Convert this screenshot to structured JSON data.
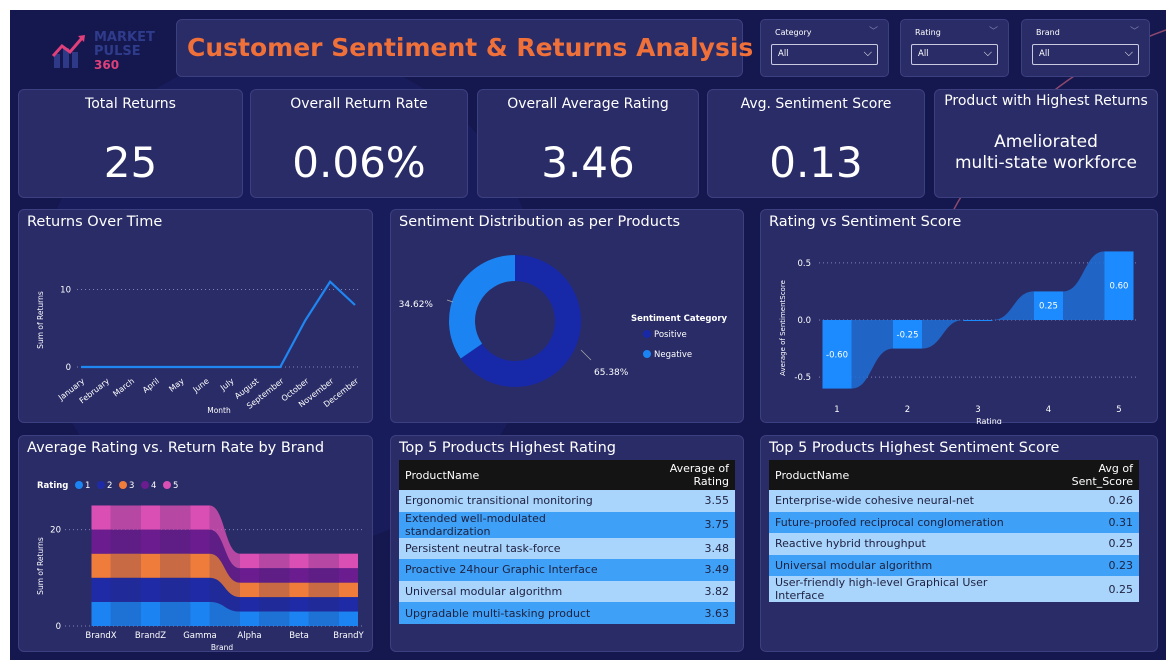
{
  "header": {
    "logo_line1": "MARKET",
    "logo_line2": "PULSE",
    "logo_line3": "360",
    "title": "Customer Sentiment & Returns Analysis"
  },
  "filters": [
    {
      "label": "Category",
      "value": "All"
    },
    {
      "label": "Rating",
      "value": "All"
    },
    {
      "label": "Brand",
      "value": "All"
    }
  ],
  "kpis": {
    "total_returns": {
      "label": "Total Returns",
      "value": "25"
    },
    "return_rate": {
      "label": "Overall Return Rate",
      "value": "0.06%"
    },
    "avg_rating": {
      "label": "Overall Average Rating",
      "value": "3.46"
    },
    "sentiment": {
      "label": "Avg. Sentiment Score",
      "value": "0.13"
    },
    "top_product": {
      "label": "Product with Highest Returns",
      "value_line1": "Ameliorated",
      "value_line2": "multi-state workforce"
    }
  },
  "colors": {
    "accent_orange": "#f0703a",
    "positive": "#1728a8",
    "negative": "#1b84f2",
    "line": "#1f86f2"
  },
  "returns_over_time": {
    "title": "Returns Over Time",
    "chart_data": {
      "type": "line",
      "categories": [
        "January",
        "February",
        "March",
        "April",
        "May",
        "June",
        "July",
        "August",
        "September",
        "October",
        "November",
        "December"
      ],
      "values": [
        0,
        0,
        0,
        0,
        0,
        0,
        0,
        0,
        0,
        6,
        11,
        8
      ],
      "xlabel": "Month",
      "ylabel": "Sum of Returns",
      "yticks": [
        0,
        10
      ],
      "ylim": [
        0,
        12
      ]
    }
  },
  "sentiment_distribution": {
    "title": "Sentiment Distribution as per Products",
    "legend_title": "Sentiment Category",
    "chart_data": {
      "type": "pie",
      "slices": [
        {
          "name": "Positive",
          "value": 65.38,
          "label": "65.38%",
          "color": "#1728a8"
        },
        {
          "name": "Negative",
          "value": 34.62,
          "label": "34.62%",
          "color": "#1b84f2"
        }
      ]
    }
  },
  "rating_vs_sentiment": {
    "title": "Rating vs Sentiment Score",
    "chart_data": {
      "type": "bar",
      "categories": [
        "1",
        "2",
        "3",
        "4",
        "5"
      ],
      "values": [
        -0.6,
        -0.25,
        0.0,
        0.25,
        0.6
      ],
      "labels": [
        "-0.60",
        "-0.25",
        "",
        "0.25",
        "0.60"
      ],
      "xlabel": "Rating",
      "ylabel": "Average of SentimentScore",
      "yticks": [
        "0.5",
        "0.0",
        "-0.5"
      ],
      "ylim": [
        -0.7,
        0.7
      ]
    }
  },
  "rating_vs_return": {
    "title": "Average Rating vs. Return Rate by Brand",
    "legend_title": "Rating",
    "chart_data": {
      "type": "bar",
      "stacked": true,
      "categories": [
        "BrandX",
        "BrandZ",
        "Gamma",
        "Alpha",
        "Beta",
        "BrandY"
      ],
      "series": [
        {
          "name": "1",
          "color": "#1b84f2",
          "values": [
            5,
            5,
            5,
            3,
            3,
            3
          ]
        },
        {
          "name": "2",
          "color": "#1f2ba6",
          "values": [
            5,
            5,
            5,
            3,
            3,
            3
          ]
        },
        {
          "name": "3",
          "color": "#f07c3c",
          "values": [
            5,
            5,
            5,
            3,
            3,
            3
          ]
        },
        {
          "name": "4",
          "color": "#6b1c8f",
          "values": [
            5,
            5,
            5,
            3,
            3,
            3
          ]
        },
        {
          "name": "5",
          "color": "#d94fb3",
          "values": [
            5,
            5,
            5,
            3,
            3,
            3
          ]
        }
      ],
      "xlabel": "Brand",
      "ylabel": "Sum of Returns",
      "yticks": [
        0,
        20
      ],
      "ylim": [
        0,
        28
      ]
    }
  },
  "top_rating": {
    "title": "Top 5 Products Highest Rating",
    "columns": [
      "ProductName",
      "Average of Rating"
    ],
    "rows": [
      [
        "Ergonomic transitional monitoring",
        "3.55"
      ],
      [
        "Extended well-modulated standardization",
        "3.75"
      ],
      [
        "Persistent neutral task-force",
        "3.48"
      ],
      [
        "Proactive 24hour Graphic Interface",
        "3.49"
      ],
      [
        "Universal modular algorithm",
        "3.82"
      ],
      [
        "Upgradable multi-tasking product",
        "3.63"
      ]
    ]
  },
  "top_sentiment": {
    "title": "Top 5 Products Highest Sentiment Score",
    "columns": [
      "ProductName",
      "Avg of Sent_Score"
    ],
    "rows": [
      [
        "Enterprise-wide cohesive neural-net",
        "0.26"
      ],
      [
        "Future-proofed reciprocal conglomeration",
        "0.31"
      ],
      [
        "Reactive hybrid throughput",
        "0.25"
      ],
      [
        "Universal modular algorithm",
        "0.23"
      ],
      [
        "User-friendly high-level Graphical User Interface",
        "0.25"
      ]
    ]
  }
}
